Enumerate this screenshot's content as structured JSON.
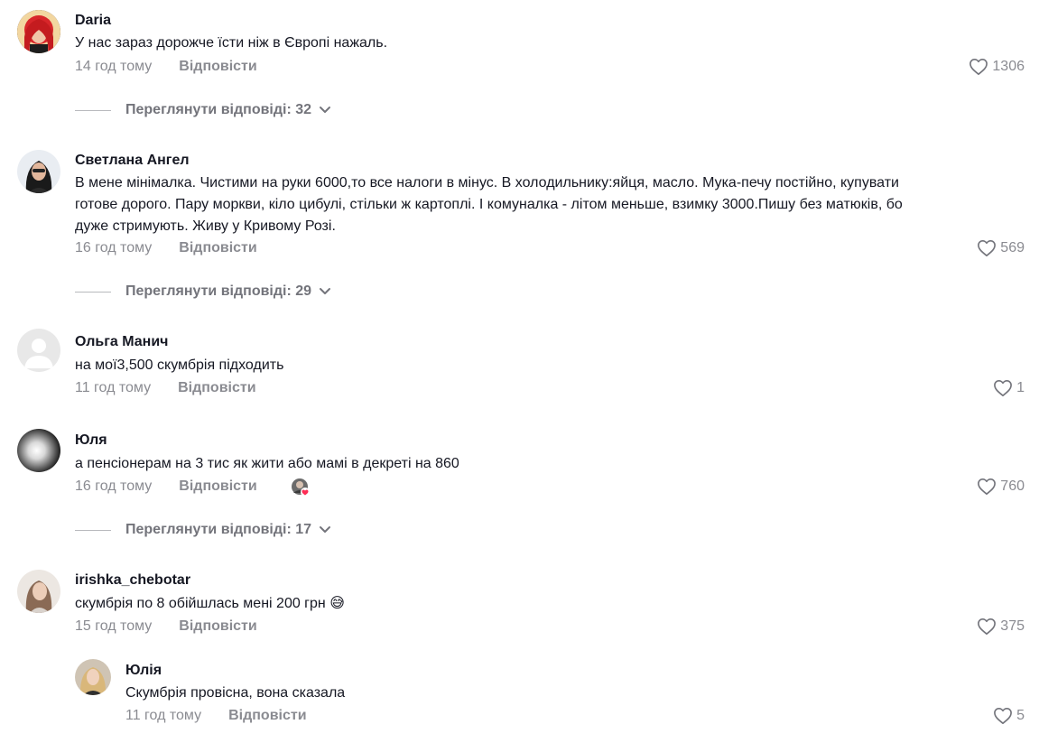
{
  "comments": [
    {
      "author": "Daria",
      "text": "У нас зараз дорожче їсти ніж в Європі нажаль.",
      "time": "14 год тому",
      "reply_label": "Відповісти",
      "likes": "1306",
      "view_replies": "Переглянути відповіді: 32"
    },
    {
      "author": "Светлана Ангел",
      "text_lines": [
        "В мене мінімалка. Чистими на руки 6000,то все налоги в мінус. В холодильнику:яйця, масло. Мука-печу постійно, купувати",
        "готове дорого. Пару моркви, кіло цибулі, стільки ж картоплі. І комуналка - літом меньше, взимку 3000.Пишу без матюків, бо",
        "дуже стримують. Живу у Кривому Розі."
      ],
      "time": "16 год тому",
      "reply_label": "Відповісти",
      "likes": "569",
      "view_replies": "Переглянути відповіді: 29"
    },
    {
      "author": "Ольга Манич",
      "text": "на мої3,500 скумбрія підходить",
      "time": "11 год тому",
      "reply_label": "Відповісти",
      "likes": "1"
    },
    {
      "author": "Юля",
      "text": "а пенсіонерам на 3 тис як жити або мамі в декреті на 860",
      "time": "16 год тому",
      "reply_label": "Відповісти",
      "likes": "760",
      "view_replies": "Переглянути відповіді: 17"
    },
    {
      "author": "irishka_chebotar",
      "text": "скумбрія по 8 обійшлась мені 200 грн 😅",
      "time": "15 год тому",
      "reply_label": "Відповісти",
      "likes": "375"
    },
    {
      "author": "Юлія",
      "text": "Скумбрія провісна, вона сказала",
      "time": "11 год тому",
      "reply_label": "Відповісти",
      "likes": "5"
    }
  ],
  "colors": {
    "text": "#161823",
    "muted": "#8a8b91",
    "liked_badge": "#fe2c55"
  }
}
